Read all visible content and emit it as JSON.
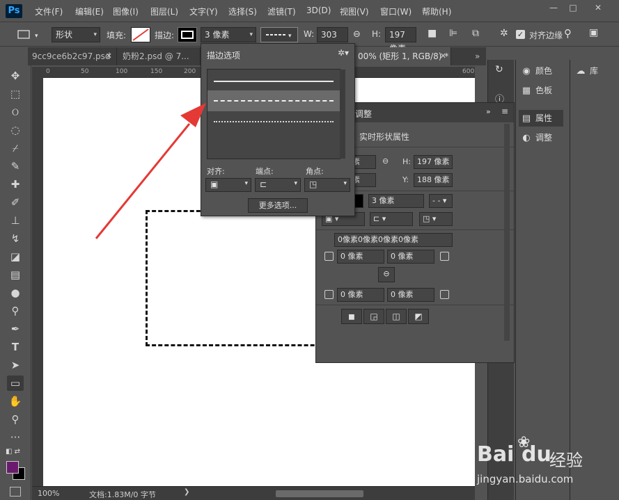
{
  "app": {
    "logo": "Ps"
  },
  "menu": [
    "文件(F)",
    "编辑(E)",
    "图像(I)",
    "图层(L)",
    "文字(Y)",
    "选择(S)",
    "滤镜(T)",
    "3D(D)",
    "视图(V)",
    "窗口(W)",
    "帮助(H)"
  ],
  "window_controls": {
    "minimize": "—",
    "restore": "□",
    "close": "✕"
  },
  "options": {
    "mode": "形状",
    "fill_label": "填充:",
    "stroke_label": "描边:",
    "stroke_width": "3 像素",
    "w_label": "W:",
    "w_value": "303 像素",
    "h_label": "H:",
    "h_value": "197 像素",
    "align_edges": "对齐边缘"
  },
  "tabs": [
    {
      "label": "9cc9ce6b2c97.psd"
    },
    {
      "label": "奶粉2.psd @ 7..."
    },
    {
      "label": "00% (矩形 1, RGB/8) *"
    }
  ],
  "tab_overflow": "»",
  "ruler_marks": [
    "0",
    "50",
    "100",
    "150",
    "200",
    "600"
  ],
  "stroke_popup": {
    "title": "描边选项",
    "align_label": "对齐:",
    "caps_label": "端点:",
    "corners_label": "角点:",
    "more_button": "更多选项..."
  },
  "properties": {
    "tab_label": "调整",
    "title": "实时形状属性",
    "w_value": "像素",
    "h_label": "H:",
    "h_value": "197 像素",
    "x_value": "像素",
    "y_label": "Y:",
    "y_value": "188 像素",
    "stroke_width": "3 像素",
    "radius_all": "0像素0像素0像素0像素",
    "r_tl": "0 像素",
    "r_tr": "0 像素",
    "r_bl": "0 像素",
    "r_br": "0 像素"
  },
  "right_panels": {
    "color": "颜色",
    "swatches": "色板",
    "properties": "属性",
    "adjustments": "调整",
    "libraries": "库"
  },
  "status": {
    "zoom": "100%",
    "doc": "文档:1.83M/0 字节"
  },
  "watermark": {
    "brand": "Bai",
    "brand2": "du",
    "brand_cn": "经验",
    "url": "jingyan.baidu.com"
  },
  "colors": {
    "accent": "#e53935",
    "foreground_swatch": "#6a1b6e",
    "background_swatch": "#000000"
  }
}
